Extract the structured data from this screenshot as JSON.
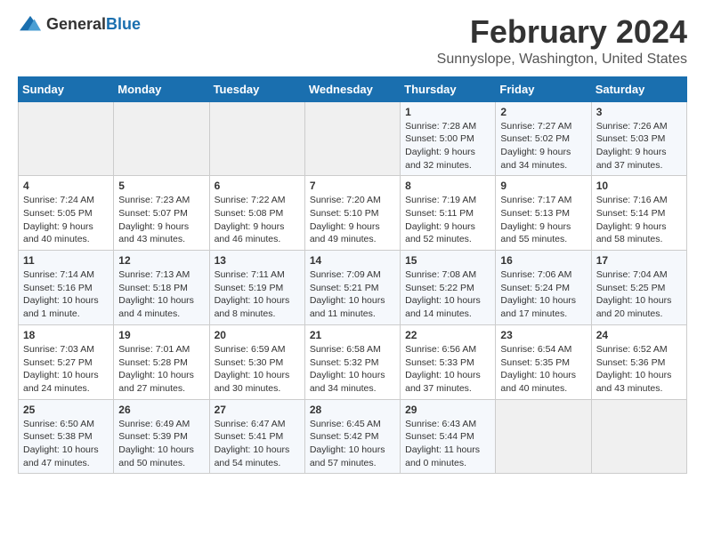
{
  "logo": {
    "text_general": "General",
    "text_blue": "Blue"
  },
  "title": {
    "month": "February 2024",
    "location": "Sunnyslope, Washington, United States"
  },
  "weekdays": [
    "Sunday",
    "Monday",
    "Tuesday",
    "Wednesday",
    "Thursday",
    "Friday",
    "Saturday"
  ],
  "weeks": [
    [
      {
        "day": "",
        "info": ""
      },
      {
        "day": "",
        "info": ""
      },
      {
        "day": "",
        "info": ""
      },
      {
        "day": "",
        "info": ""
      },
      {
        "day": "1",
        "info": "Sunrise: 7:28 AM\nSunset: 5:00 PM\nDaylight: 9 hours\nand 32 minutes."
      },
      {
        "day": "2",
        "info": "Sunrise: 7:27 AM\nSunset: 5:02 PM\nDaylight: 9 hours\nand 34 minutes."
      },
      {
        "day": "3",
        "info": "Sunrise: 7:26 AM\nSunset: 5:03 PM\nDaylight: 9 hours\nand 37 minutes."
      }
    ],
    [
      {
        "day": "4",
        "info": "Sunrise: 7:24 AM\nSunset: 5:05 PM\nDaylight: 9 hours\nand 40 minutes."
      },
      {
        "day": "5",
        "info": "Sunrise: 7:23 AM\nSunset: 5:07 PM\nDaylight: 9 hours\nand 43 minutes."
      },
      {
        "day": "6",
        "info": "Sunrise: 7:22 AM\nSunset: 5:08 PM\nDaylight: 9 hours\nand 46 minutes."
      },
      {
        "day": "7",
        "info": "Sunrise: 7:20 AM\nSunset: 5:10 PM\nDaylight: 9 hours\nand 49 minutes."
      },
      {
        "day": "8",
        "info": "Sunrise: 7:19 AM\nSunset: 5:11 PM\nDaylight: 9 hours\nand 52 minutes."
      },
      {
        "day": "9",
        "info": "Sunrise: 7:17 AM\nSunset: 5:13 PM\nDaylight: 9 hours\nand 55 minutes."
      },
      {
        "day": "10",
        "info": "Sunrise: 7:16 AM\nSunset: 5:14 PM\nDaylight: 9 hours\nand 58 minutes."
      }
    ],
    [
      {
        "day": "11",
        "info": "Sunrise: 7:14 AM\nSunset: 5:16 PM\nDaylight: 10 hours\nand 1 minute."
      },
      {
        "day": "12",
        "info": "Sunrise: 7:13 AM\nSunset: 5:18 PM\nDaylight: 10 hours\nand 4 minutes."
      },
      {
        "day": "13",
        "info": "Sunrise: 7:11 AM\nSunset: 5:19 PM\nDaylight: 10 hours\nand 8 minutes."
      },
      {
        "day": "14",
        "info": "Sunrise: 7:09 AM\nSunset: 5:21 PM\nDaylight: 10 hours\nand 11 minutes."
      },
      {
        "day": "15",
        "info": "Sunrise: 7:08 AM\nSunset: 5:22 PM\nDaylight: 10 hours\nand 14 minutes."
      },
      {
        "day": "16",
        "info": "Sunrise: 7:06 AM\nSunset: 5:24 PM\nDaylight: 10 hours\nand 17 minutes."
      },
      {
        "day": "17",
        "info": "Sunrise: 7:04 AM\nSunset: 5:25 PM\nDaylight: 10 hours\nand 20 minutes."
      }
    ],
    [
      {
        "day": "18",
        "info": "Sunrise: 7:03 AM\nSunset: 5:27 PM\nDaylight: 10 hours\nand 24 minutes."
      },
      {
        "day": "19",
        "info": "Sunrise: 7:01 AM\nSunset: 5:28 PM\nDaylight: 10 hours\nand 27 minutes."
      },
      {
        "day": "20",
        "info": "Sunrise: 6:59 AM\nSunset: 5:30 PM\nDaylight: 10 hours\nand 30 minutes."
      },
      {
        "day": "21",
        "info": "Sunrise: 6:58 AM\nSunset: 5:32 PM\nDaylight: 10 hours\nand 34 minutes."
      },
      {
        "day": "22",
        "info": "Sunrise: 6:56 AM\nSunset: 5:33 PM\nDaylight: 10 hours\nand 37 minutes."
      },
      {
        "day": "23",
        "info": "Sunrise: 6:54 AM\nSunset: 5:35 PM\nDaylight: 10 hours\nand 40 minutes."
      },
      {
        "day": "24",
        "info": "Sunrise: 6:52 AM\nSunset: 5:36 PM\nDaylight: 10 hours\nand 43 minutes."
      }
    ],
    [
      {
        "day": "25",
        "info": "Sunrise: 6:50 AM\nSunset: 5:38 PM\nDaylight: 10 hours\nand 47 minutes."
      },
      {
        "day": "26",
        "info": "Sunrise: 6:49 AM\nSunset: 5:39 PM\nDaylight: 10 hours\nand 50 minutes."
      },
      {
        "day": "27",
        "info": "Sunrise: 6:47 AM\nSunset: 5:41 PM\nDaylight: 10 hours\nand 54 minutes."
      },
      {
        "day": "28",
        "info": "Sunrise: 6:45 AM\nSunset: 5:42 PM\nDaylight: 10 hours\nand 57 minutes."
      },
      {
        "day": "29",
        "info": "Sunrise: 6:43 AM\nSunset: 5:44 PM\nDaylight: 11 hours\nand 0 minutes."
      },
      {
        "day": "",
        "info": ""
      },
      {
        "day": "",
        "info": ""
      }
    ]
  ]
}
